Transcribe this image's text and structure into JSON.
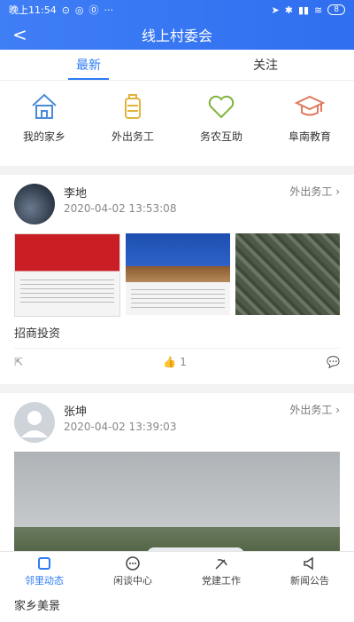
{
  "status": {
    "time": "晚上11:54",
    "battery": "8"
  },
  "header": {
    "title": "线上村委会",
    "back": "<"
  },
  "tabs": [
    {
      "label": "最新",
      "active": true
    },
    {
      "label": "关注",
      "active": false
    }
  ],
  "categories": [
    {
      "label": "我的家乡",
      "icon": "home-icon"
    },
    {
      "label": "外出务工",
      "icon": "luggage-icon"
    },
    {
      "label": "务农互助",
      "icon": "heart-icon"
    },
    {
      "label": "阜南教育",
      "icon": "graduation-cap-icon"
    }
  ],
  "posts": [
    {
      "name": "李地",
      "time": "2020-04-02 13:53:08",
      "tag": "外出务工",
      "title": "招商投资",
      "likes": "1"
    },
    {
      "name": "张坤",
      "time": "2020-04-02 13:39:03",
      "tag": "外出务工",
      "title": "家乡美景"
    }
  ],
  "bottom_nav": [
    {
      "label": "邻里动态",
      "icon": "square-icon",
      "active": true
    },
    {
      "label": "闲谈中心",
      "icon": "chat-icon",
      "active": false
    },
    {
      "label": "党建工作",
      "icon": "emblem-icon",
      "active": false
    },
    {
      "label": "新闻公告",
      "icon": "megaphone-icon",
      "active": false
    }
  ],
  "colors": {
    "primary": "#2d7cf6",
    "home": "#4a8bd8",
    "luggage": "#e0b33a",
    "heart": "#7fb23a",
    "cap": "#e07a5f"
  }
}
